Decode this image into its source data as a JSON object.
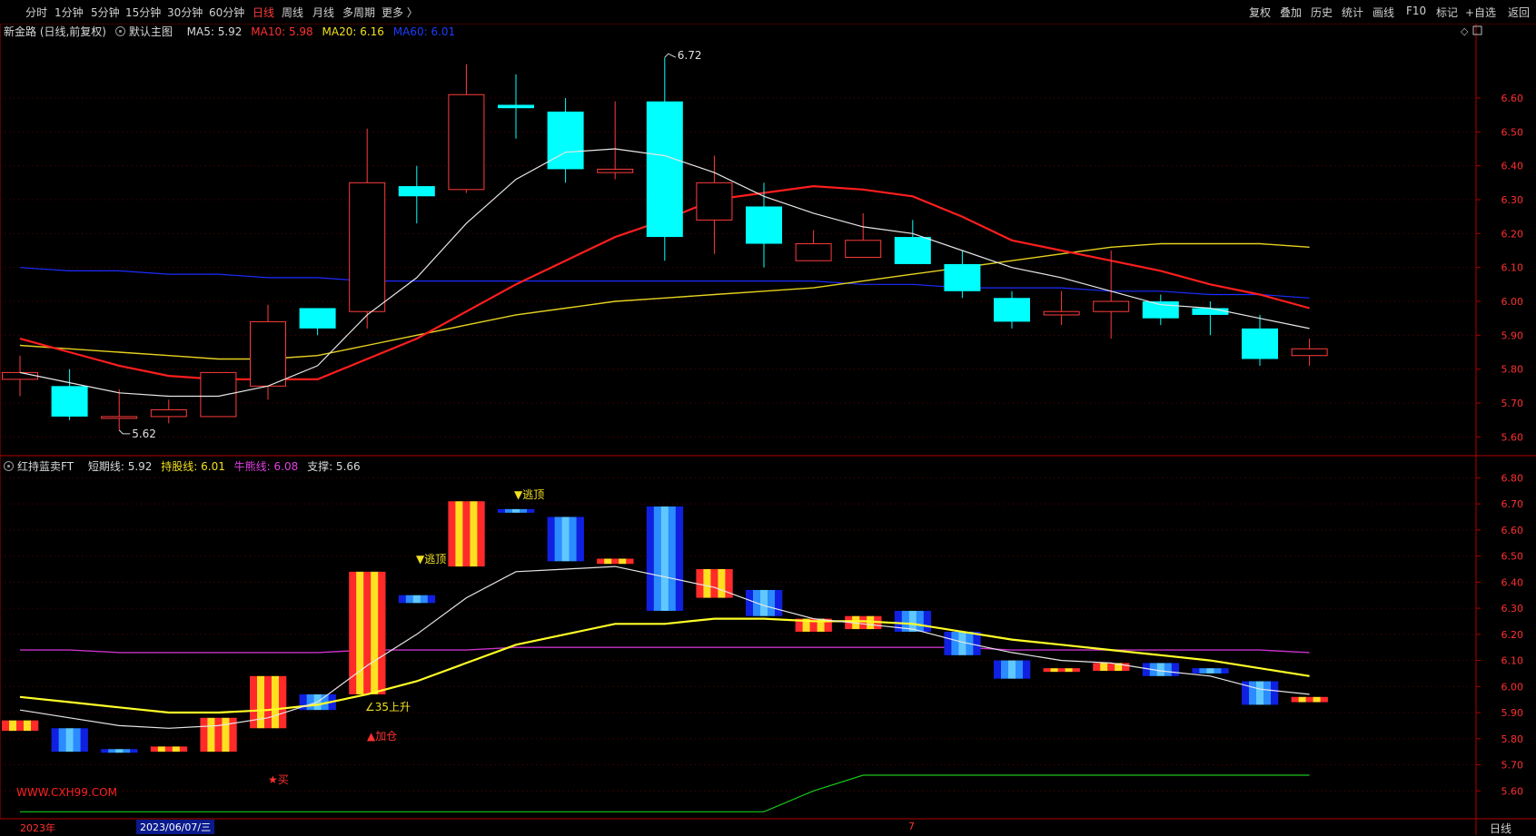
{
  "toolbar": {
    "left_items": [
      {
        "label": "分时",
        "active": false
      },
      {
        "label": "1分钟",
        "active": false
      },
      {
        "label": "5分钟",
        "active": false
      },
      {
        "label": "15分钟",
        "active": false
      },
      {
        "label": "30分钟",
        "active": false
      },
      {
        "label": "60分钟",
        "active": false
      },
      {
        "label": "日线",
        "active": true
      },
      {
        "label": "周线",
        "active": false
      },
      {
        "label": "月线",
        "active": false
      },
      {
        "label": "多周期",
        "active": false
      },
      {
        "label": "更多 〉",
        "active": false
      }
    ],
    "right_items": [
      "复权",
      "叠加",
      "历史",
      "统计",
      "画线",
      "F10",
      "标记",
      "+自选",
      "返回"
    ]
  },
  "main_legend": {
    "stock": "新金路 (日线,前复权)",
    "template": "默认主图",
    "ma5": "MA5: 5.92",
    "ma10": "MA10: 5.98",
    "ma20": "MA20: 6.16",
    "ma60": "MA60: 6.01"
  },
  "sub_legend": {
    "name": "红持蓝卖FT",
    "short": "短期线: 5.92",
    "hold": "持股线: 6.01",
    "bull": "牛熊线: 6.08",
    "support": "支撑: 5.66"
  },
  "signals": {
    "top1": "▼逃顶",
    "top2": "▼逃顶",
    "rise": "∠35上升",
    "add": "▲加仓",
    "buy": "★买"
  },
  "watermark": "WWW.CXH99.COM",
  "datebar": {
    "year": "2023年",
    "cursor_date": "2023/06/07/三",
    "month_mark": "7",
    "period": "日线"
  },
  "colors": {
    "up": "#ff3b3b",
    "down": "#00ffff",
    "ma5": "#e6e6e6",
    "ma10": "#ff1e1e",
    "ma20": "#e6d21e",
    "ma60": "#1c2cff",
    "hold": "#ffff28",
    "bull": "#c832c8",
    "support": "#18c818",
    "axis": "#b00000"
  },
  "chart_data": [
    {
      "type": "candlestick",
      "title": "新金路 (日线,前复权)",
      "price_labels": {
        "high": "6.72",
        "low": "5.62"
      },
      "yticks": [
        5.6,
        5.7,
        5.8,
        5.9,
        6.0,
        6.1,
        6.2,
        6.3,
        6.4,
        6.5,
        6.6
      ],
      "ylim": [
        5.55,
        6.75
      ],
      "candles": [
        {
          "o": 5.77,
          "c": 5.79,
          "h": 5.84,
          "l": 5.72
        },
        {
          "o": 5.75,
          "c": 5.66,
          "h": 5.8,
          "l": 5.65
        },
        {
          "o": 5.66,
          "c": 5.66,
          "h": 5.74,
          "l": 5.62
        },
        {
          "o": 5.66,
          "c": 5.68,
          "h": 5.71,
          "l": 5.64
        },
        {
          "o": 5.66,
          "c": 5.79,
          "h": 5.79,
          "l": 5.66
        },
        {
          "o": 5.75,
          "c": 5.94,
          "h": 5.99,
          "l": 5.71
        },
        {
          "o": 5.98,
          "c": 5.92,
          "h": 5.98,
          "l": 5.9
        },
        {
          "o": 5.97,
          "c": 6.35,
          "h": 6.51,
          "l": 5.92
        },
        {
          "o": 6.34,
          "c": 6.31,
          "h": 6.4,
          "l": 6.23
        },
        {
          "o": 6.33,
          "c": 6.61,
          "h": 6.7,
          "l": 6.32
        },
        {
          "o": 6.58,
          "c": 6.57,
          "h": 6.67,
          "l": 6.48
        },
        {
          "o": 6.56,
          "c": 6.39,
          "h": 6.6,
          "l": 6.35
        },
        {
          "o": 6.38,
          "c": 6.39,
          "h": 6.59,
          "l": 6.36
        },
        {
          "o": 6.59,
          "c": 6.19,
          "h": 6.72,
          "l": 6.12
        },
        {
          "o": 6.24,
          "c": 6.35,
          "h": 6.43,
          "l": 6.14
        },
        {
          "o": 6.28,
          "c": 6.17,
          "h": 6.35,
          "l": 6.1
        },
        {
          "o": 6.12,
          "c": 6.17,
          "h": 6.21,
          "l": 6.12
        },
        {
          "o": 6.13,
          "c": 6.18,
          "h": 6.26,
          "l": 6.13
        },
        {
          "o": 6.19,
          "c": 6.11,
          "h": 6.24,
          "l": 6.11
        },
        {
          "o": 6.11,
          "c": 6.03,
          "h": 6.15,
          "l": 6.01
        },
        {
          "o": 6.01,
          "c": 5.94,
          "h": 6.03,
          "l": 5.92
        },
        {
          "o": 5.96,
          "c": 5.97,
          "h": 6.03,
          "l": 5.93
        },
        {
          "o": 5.97,
          "c": 6.0,
          "h": 6.15,
          "l": 5.89
        },
        {
          "o": 6.0,
          "c": 5.95,
          "h": 6.02,
          "l": 5.93
        },
        {
          "o": 5.98,
          "c": 5.96,
          "h": 6.0,
          "l": 5.9
        },
        {
          "o": 5.92,
          "c": 5.83,
          "h": 5.96,
          "l": 5.81
        },
        {
          "o": 5.84,
          "c": 5.86,
          "h": 5.89,
          "l": 5.81
        }
      ],
      "series": [
        {
          "name": "MA5",
          "values": [
            5.79,
            5.76,
            5.73,
            5.72,
            5.72,
            5.75,
            5.81,
            5.96,
            6.07,
            6.23,
            6.36,
            6.44,
            6.45,
            6.43,
            6.38,
            6.31,
            6.26,
            6.22,
            6.2,
            6.15,
            6.1,
            6.07,
            6.03,
            5.99,
            5.98,
            5.95,
            5.92
          ]
        },
        {
          "name": "MA10",
          "values": [
            5.89,
            5.85,
            5.81,
            5.78,
            5.77,
            5.77,
            5.77,
            5.83,
            5.89,
            5.97,
            6.05,
            6.12,
            6.19,
            6.24,
            6.3,
            6.32,
            6.34,
            6.33,
            6.31,
            6.25,
            6.18,
            6.15,
            6.12,
            6.09,
            6.05,
            6.02,
            5.98
          ]
        },
        {
          "name": "MA20",
          "values": [
            5.87,
            5.86,
            5.85,
            5.84,
            5.83,
            5.83,
            5.84,
            5.87,
            5.9,
            5.93,
            5.96,
            5.98,
            6.0,
            6.01,
            6.02,
            6.03,
            6.04,
            6.06,
            6.08,
            6.1,
            6.12,
            6.14,
            6.16,
            6.17,
            6.17,
            6.17,
            6.16
          ]
        },
        {
          "name": "MA60",
          "values": [
            6.1,
            6.09,
            6.09,
            6.08,
            6.08,
            6.07,
            6.07,
            6.06,
            6.06,
            6.06,
            6.06,
            6.06,
            6.06,
            6.06,
            6.06,
            6.06,
            6.06,
            6.05,
            6.05,
            6.04,
            6.04,
            6.04,
            6.03,
            6.03,
            6.02,
            6.02,
            6.01
          ]
        }
      ]
    },
    {
      "type": "bar",
      "title": "红持蓝卖FT",
      "yticks": [
        5.6,
        5.7,
        5.8,
        5.9,
        6.0,
        6.1,
        6.2,
        6.3,
        6.4,
        6.5,
        6.6,
        6.7,
        6.8
      ],
      "ylim": [
        5.5,
        6.85
      ],
      "bars": [
        {
          "top": 5.87,
          "bottom": 5.83,
          "color": "red"
        },
        {
          "top": 5.84,
          "bottom": 5.75,
          "color": "blue"
        },
        {
          "top": 5.76,
          "bottom": 5.75,
          "color": "blue"
        },
        {
          "top": 5.77,
          "bottom": 5.75,
          "color": "red"
        },
        {
          "top": 5.88,
          "bottom": 5.75,
          "color": "red"
        },
        {
          "top": 6.04,
          "bottom": 5.84,
          "color": "red"
        },
        {
          "top": 5.97,
          "bottom": 5.91,
          "color": "blue"
        },
        {
          "top": 6.44,
          "bottom": 5.97,
          "color": "red"
        },
        {
          "top": 6.35,
          "bottom": 6.32,
          "color": "blue"
        },
        {
          "top": 6.71,
          "bottom": 6.46,
          "color": "red"
        },
        {
          "top": 6.68,
          "bottom": 6.67,
          "color": "blue"
        },
        {
          "top": 6.65,
          "bottom": 6.48,
          "color": "blue"
        },
        {
          "top": 6.49,
          "bottom": 6.47,
          "color": "red"
        },
        {
          "top": 6.69,
          "bottom": 6.29,
          "color": "blue"
        },
        {
          "top": 6.45,
          "bottom": 6.34,
          "color": "red"
        },
        {
          "top": 6.37,
          "bottom": 6.27,
          "color": "blue"
        },
        {
          "top": 6.26,
          "bottom": 6.21,
          "color": "red"
        },
        {
          "top": 6.27,
          "bottom": 6.22,
          "color": "red"
        },
        {
          "top": 6.29,
          "bottom": 6.21,
          "color": "blue"
        },
        {
          "top": 6.21,
          "bottom": 6.12,
          "color": "blue"
        },
        {
          "top": 6.1,
          "bottom": 6.03,
          "color": "blue"
        },
        {
          "top": 6.07,
          "bottom": 6.06,
          "color": "red"
        },
        {
          "top": 6.09,
          "bottom": 6.06,
          "color": "red"
        },
        {
          "top": 6.09,
          "bottom": 6.04,
          "color": "blue"
        },
        {
          "top": 6.07,
          "bottom": 6.05,
          "color": "blue"
        },
        {
          "top": 6.02,
          "bottom": 5.93,
          "color": "blue"
        },
        {
          "top": 5.96,
          "bottom": 5.94,
          "color": "red"
        }
      ],
      "series": [
        {
          "name": "短期线",
          "values": [
            5.91,
            5.88,
            5.85,
            5.84,
            5.85,
            5.88,
            5.94,
            6.08,
            6.2,
            6.34,
            6.44,
            6.45,
            6.46,
            6.42,
            6.38,
            6.31,
            6.26,
            6.24,
            6.22,
            6.17,
            6.13,
            6.1,
            6.09,
            6.06,
            6.04,
            5.99,
            5.97
          ]
        },
        {
          "name": "持股线",
          "values": [
            5.96,
            5.94,
            5.92,
            5.9,
            5.9,
            5.91,
            5.93,
            5.97,
            6.02,
            6.09,
            6.16,
            6.2,
            6.24,
            6.24,
            6.26,
            6.26,
            6.25,
            6.25,
            6.24,
            6.21,
            6.18,
            6.16,
            6.14,
            6.12,
            6.1,
            6.07,
            6.04
          ]
        },
        {
          "name": "牛熊线",
          "values": [
            6.14,
            6.14,
            6.13,
            6.13,
            6.13,
            6.13,
            6.13,
            6.14,
            6.14,
            6.14,
            6.15,
            6.15,
            6.15,
            6.15,
            6.15,
            6.15,
            6.15,
            6.15,
            6.15,
            6.15,
            6.14,
            6.14,
            6.14,
            6.14,
            6.14,
            6.14,
            6.13
          ]
        },
        {
          "name": "支撑",
          "values": [
            5.52,
            5.52,
            5.52,
            5.52,
            5.52,
            5.52,
            5.52,
            5.52,
            5.52,
            5.52,
            5.52,
            5.52,
            5.52,
            5.52,
            5.52,
            5.52,
            5.6,
            5.66,
            5.66,
            5.66,
            5.66,
            5.66,
            5.66,
            5.66,
            5.66,
            5.66,
            5.66
          ]
        }
      ]
    }
  ]
}
